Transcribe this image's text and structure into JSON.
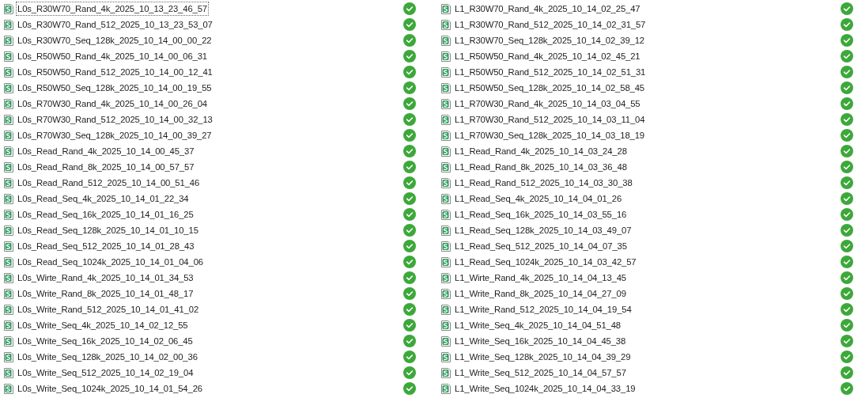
{
  "columns": [
    {
      "items": [
        {
          "name": "L0s_R30W70_Rand_4k_2025_10_13_23_46_57",
          "selected": true,
          "synced": true
        },
        {
          "name": "L0s_R30W70_Rand_512_2025_10_13_23_53_07",
          "selected": false,
          "synced": true
        },
        {
          "name": "L0s_R30W70_Seq_128k_2025_10_14_00_00_22",
          "selected": false,
          "synced": true
        },
        {
          "name": "L0s_R50W50_Rand_4k_2025_10_14_00_06_31",
          "selected": false,
          "synced": true
        },
        {
          "name": "L0s_R50W50_Rand_512_2025_10_14_00_12_41",
          "selected": false,
          "synced": true
        },
        {
          "name": "L0s_R50W50_Seq_128k_2025_10_14_00_19_55",
          "selected": false,
          "synced": true
        },
        {
          "name": "L0s_R70W30_Rand_4k_2025_10_14_00_26_04",
          "selected": false,
          "synced": true
        },
        {
          "name": "L0s_R70W30_Rand_512_2025_10_14_00_32_13",
          "selected": false,
          "synced": true
        },
        {
          "name": "L0s_R70W30_Seq_128k_2025_10_14_00_39_27",
          "selected": false,
          "synced": true
        },
        {
          "name": "L0s_Read_Rand_4k_2025_10_14_00_45_37",
          "selected": false,
          "synced": true
        },
        {
          "name": "L0s_Read_Rand_8k_2025_10_14_00_57_57",
          "selected": false,
          "synced": true
        },
        {
          "name": "L0s_Read_Rand_512_2025_10_14_00_51_46",
          "selected": false,
          "synced": true
        },
        {
          "name": "L0s_Read_Seq_4k_2025_10_14_01_22_34",
          "selected": false,
          "synced": true
        },
        {
          "name": "L0s_Read_Seq_16k_2025_10_14_01_16_25",
          "selected": false,
          "synced": true
        },
        {
          "name": "L0s_Read_Seq_128k_2025_10_14_01_10_15",
          "selected": false,
          "synced": true
        },
        {
          "name": "L0s_Read_Seq_512_2025_10_14_01_28_43",
          "selected": false,
          "synced": true
        },
        {
          "name": "L0s_Read_Seq_1024k_2025_10_14_01_04_06",
          "selected": false,
          "synced": true
        },
        {
          "name": "L0s_Wirte_Rand_4k_2025_10_14_01_34_53",
          "selected": false,
          "synced": true
        },
        {
          "name": "L0s_Write_Rand_8k_2025_10_14_01_48_17",
          "selected": false,
          "synced": true
        },
        {
          "name": "L0s_Write_Rand_512_2025_10_14_01_41_02",
          "selected": false,
          "synced": true
        },
        {
          "name": "L0s_Write_Seq_4k_2025_10_14_02_12_55",
          "selected": false,
          "synced": true
        },
        {
          "name": "L0s_Write_Seq_16k_2025_10_14_02_06_45",
          "selected": false,
          "synced": true
        },
        {
          "name": "L0s_Write_Seq_128k_2025_10_14_02_00_36",
          "selected": false,
          "synced": true
        },
        {
          "name": "L0s_Write_Seq_512_2025_10_14_02_19_04",
          "selected": false,
          "synced": true
        },
        {
          "name": "L0s_Write_Seq_1024k_2025_10_14_01_54_26",
          "selected": false,
          "synced": true
        }
      ]
    },
    {
      "items": [
        {
          "name": "L1_R30W70_Rand_4k_2025_10_14_02_25_47",
          "selected": false,
          "synced": true
        },
        {
          "name": "L1_R30W70_Rand_512_2025_10_14_02_31_57",
          "selected": false,
          "synced": true
        },
        {
          "name": "L1_R30W70_Seq_128k_2025_10_14_02_39_12",
          "selected": false,
          "synced": true
        },
        {
          "name": "L1_R50W50_Rand_4k_2025_10_14_02_45_21",
          "selected": false,
          "synced": true
        },
        {
          "name": "L1_R50W50_Rand_512_2025_10_14_02_51_31",
          "selected": false,
          "synced": true
        },
        {
          "name": "L1_R50W50_Seq_128k_2025_10_14_02_58_45",
          "selected": false,
          "synced": true
        },
        {
          "name": "L1_R70W30_Rand_4k_2025_10_14_03_04_55",
          "selected": false,
          "synced": true
        },
        {
          "name": "L1_R70W30_Rand_512_2025_10_14_03_11_04",
          "selected": false,
          "synced": true
        },
        {
          "name": "L1_R70W30_Seq_128k_2025_10_14_03_18_19",
          "selected": false,
          "synced": true
        },
        {
          "name": "L1_Read_Rand_4k_2025_10_14_03_24_28",
          "selected": false,
          "synced": true
        },
        {
          "name": "L1_Read_Rand_8k_2025_10_14_03_36_48",
          "selected": false,
          "synced": true
        },
        {
          "name": "L1_Read_Rand_512_2025_10_14_03_30_38",
          "selected": false,
          "synced": true
        },
        {
          "name": "L1_Read_Seq_4k_2025_10_14_04_01_26",
          "selected": false,
          "synced": true
        },
        {
          "name": "L1_Read_Seq_16k_2025_10_14_03_55_16",
          "selected": false,
          "synced": true
        },
        {
          "name": "L1_Read_Seq_128k_2025_10_14_03_49_07",
          "selected": false,
          "synced": true
        },
        {
          "name": "L1_Read_Seq_512_2025_10_14_04_07_35",
          "selected": false,
          "synced": true
        },
        {
          "name": "L1_Read_Seq_1024k_2025_10_14_03_42_57",
          "selected": false,
          "synced": true
        },
        {
          "name": "L1_Wirte_Rand_4k_2025_10_14_04_13_45",
          "selected": false,
          "synced": true
        },
        {
          "name": "L1_Write_Rand_8k_2025_10_14_04_27_09",
          "selected": false,
          "synced": true
        },
        {
          "name": "L1_Write_Rand_512_2025_10_14_04_19_54",
          "selected": false,
          "synced": true
        },
        {
          "name": "L1_Write_Seq_4k_2025_10_14_04_51_48",
          "selected": false,
          "synced": true
        },
        {
          "name": "L1_Write_Seq_16k_2025_10_14_04_45_38",
          "selected": false,
          "synced": true
        },
        {
          "name": "L1_Write_Seq_128k_2025_10_14_04_39_29",
          "selected": false,
          "synced": true
        },
        {
          "name": "L1_Write_Seq_512_2025_10_14_04_57_57",
          "selected": false,
          "synced": true
        },
        {
          "name": "L1_Write_Seq_1024k_2025_10_14_04_33_19",
          "selected": false,
          "synced": true
        }
      ]
    }
  ]
}
